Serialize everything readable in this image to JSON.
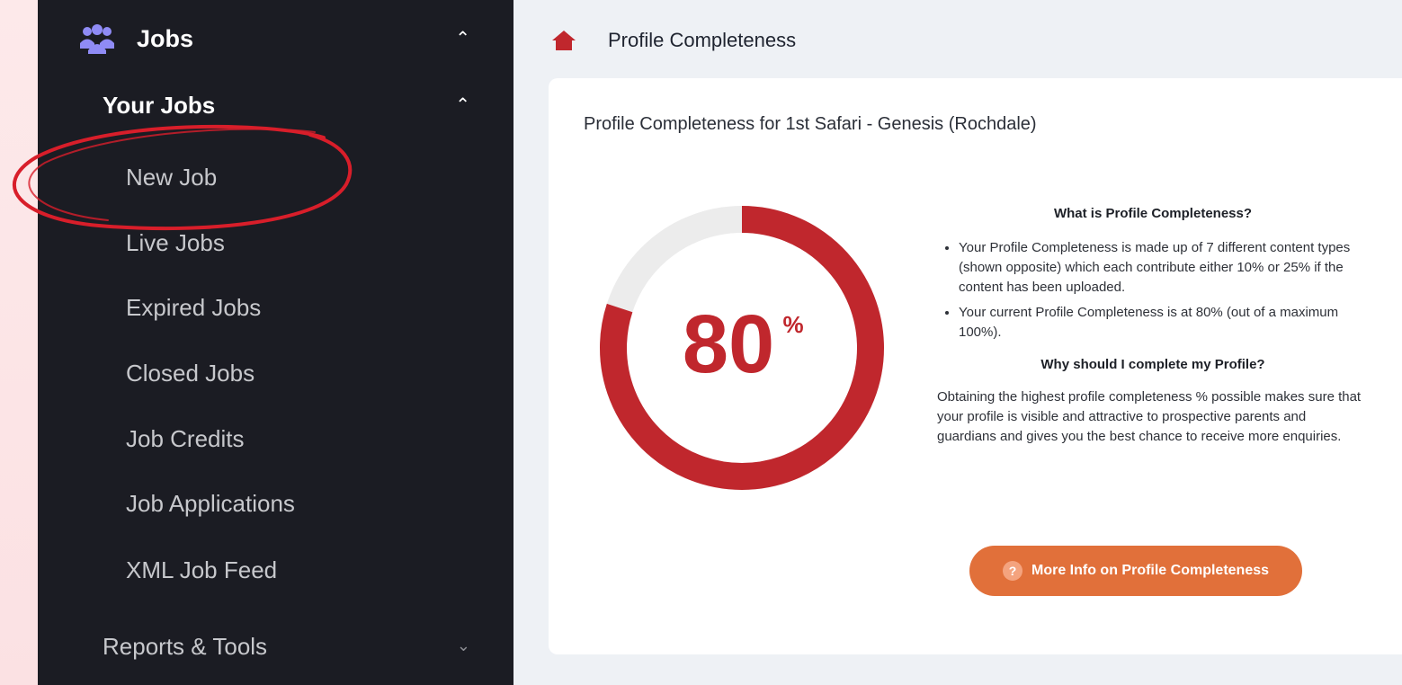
{
  "sidebar": {
    "section": {
      "label": "Jobs",
      "icon": "people-icon"
    },
    "group": {
      "label": "Your Jobs"
    },
    "items": [
      {
        "label": "New Job",
        "highlighted": true
      },
      {
        "label": "Live Jobs"
      },
      {
        "label": "Expired Jobs"
      },
      {
        "label": "Closed Jobs"
      },
      {
        "label": "Job Credits"
      },
      {
        "label": "Job Applications"
      },
      {
        "label": "XML Job Feed"
      }
    ],
    "reports": {
      "label": "Reports & Tools"
    }
  },
  "header": {
    "title": "Profile Completeness",
    "icon": "home-icon"
  },
  "card": {
    "title": "Profile Completeness for 1st Safari - Genesis (Rochdale)",
    "donut": {
      "value": 80,
      "value_text": "80",
      "unit": "%"
    },
    "info": {
      "heading1": "What is Profile Completeness?",
      "bullets": [
        "Your Profile Completeness is made up of 7 different content types (shown opposite) which each contribute either 10% or 25% if the content has been uploaded.",
        "Your current Profile Completeness is at 80% (out of a maximum 100%)."
      ],
      "heading2": "Why should I complete my Profile?",
      "paragraph": "Obtaining the highest profile completeness % possible makes sure that your profile is visible and attractive to prospective parents and guardians and gives you the best chance to receive more enquiries."
    },
    "button": {
      "label": "More Info on Profile Completeness",
      "icon": "question-icon"
    }
  },
  "colors": {
    "accent": "#c0272d",
    "button": "#e1703a",
    "sidebar": "#1b1c23"
  }
}
